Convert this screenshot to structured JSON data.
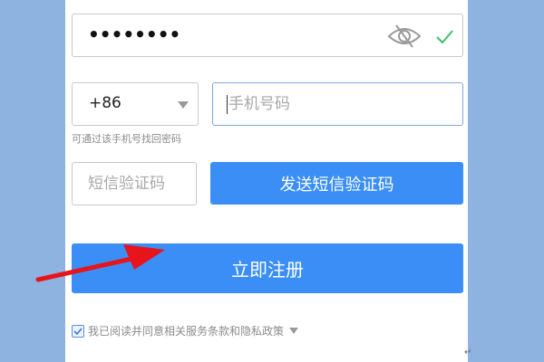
{
  "password": {
    "masked_value": "••••••••",
    "visibility_icon": "eye-slash-icon",
    "valid_icon": "checkmark-icon",
    "valid_color": "#3cc06c"
  },
  "phone": {
    "country_code": "+86",
    "placeholder": "手机号码",
    "hint": "可通过该手机号找回密码"
  },
  "sms": {
    "placeholder": "短信验证码",
    "send_label": "发送短信验证码"
  },
  "register": {
    "label": "立即注册"
  },
  "agreement": {
    "checked": true,
    "text": "我已阅读并同意相关服务条款和隐私政策"
  },
  "colors": {
    "accent": "#3a8ef6",
    "page_background": "#8fb3e0",
    "annotation_arrow": "#e8141c"
  },
  "annotation": {
    "arrow_icon": "red-arrow-icon",
    "return_mark": "↵"
  }
}
